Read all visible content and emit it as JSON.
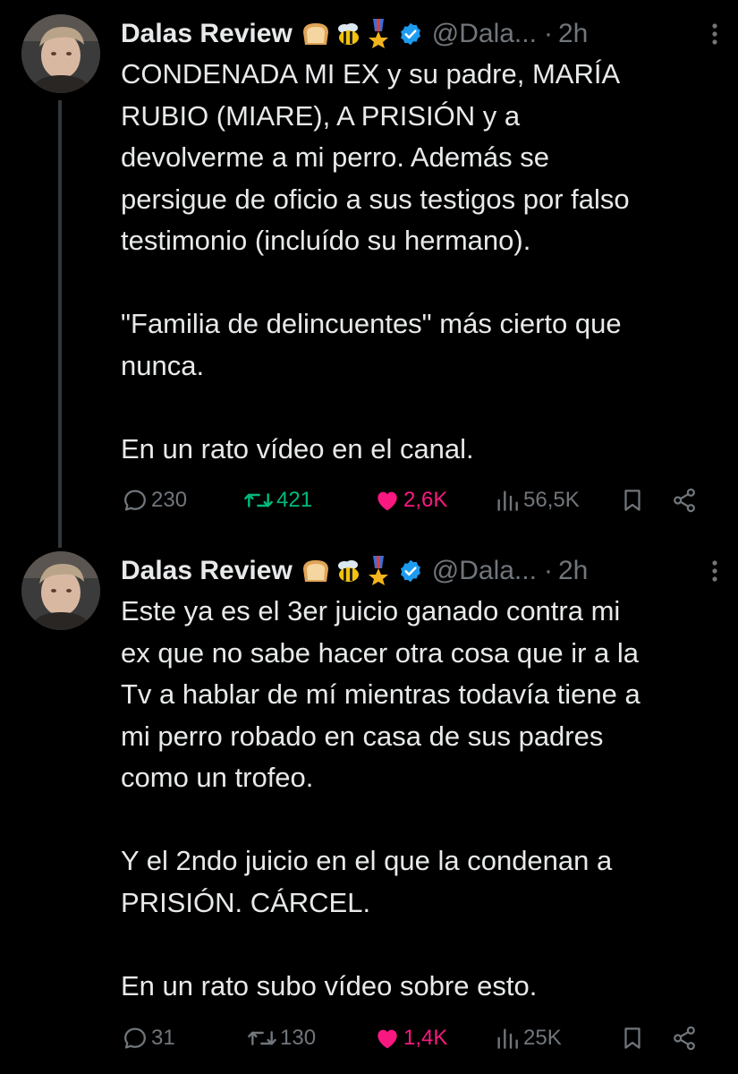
{
  "colors": {
    "background": "#000000",
    "text": "#e7e9ea",
    "secondary": "#71767b",
    "verified": "#1d9bf0",
    "retweet": "#00ba7c",
    "like": "#f91880"
  },
  "tweets": [
    {
      "author": {
        "name": "Dalas Review",
        "emojis": [
          "bread-emoji",
          "bee-emoji",
          "medal-emoji"
        ],
        "verified": true,
        "handle": "@Dala...",
        "time": "2h"
      },
      "paragraphs": [
        [
          "CONDENADA MI EX y su padre, MARÍA",
          "RUBIO (MIARE), A PRISIÓN y a",
          "devolverme a mi perro. Además se",
          "persigue de oficio a sus testigos por falso",
          "testimonio (incluído su hermano)."
        ],
        [
          "\"Familia de delincuentes\" más cierto que",
          "nunca."
        ],
        [
          "En un rato vídeo en el canal."
        ]
      ],
      "stats": {
        "replies": "230",
        "retweets": "421",
        "likes": "2,6K",
        "views": "56,5K"
      },
      "liked": true
    },
    {
      "author": {
        "name": "Dalas Review",
        "emojis": [
          "bread-emoji",
          "bee-emoji",
          "medal-emoji"
        ],
        "verified": true,
        "handle": "@Dala...",
        "time": "2h"
      },
      "paragraphs": [
        [
          "Este ya es el 3er juicio ganado contra mi",
          "ex que no sabe hacer otra cosa que ir a la",
          "Tv a hablar de mí mientras todavía tiene a",
          "mi perro robado en casa de sus padres",
          "como un trofeo."
        ],
        [
          "Y el 2ndo juicio en el que la condenan a",
          "PRISIÓN. CÁRCEL."
        ],
        [
          "En un rato subo vídeo sobre esto."
        ]
      ],
      "stats": {
        "replies": "31",
        "retweets": "130",
        "likes": "1,4K",
        "views": "25K"
      },
      "liked": true
    }
  ]
}
